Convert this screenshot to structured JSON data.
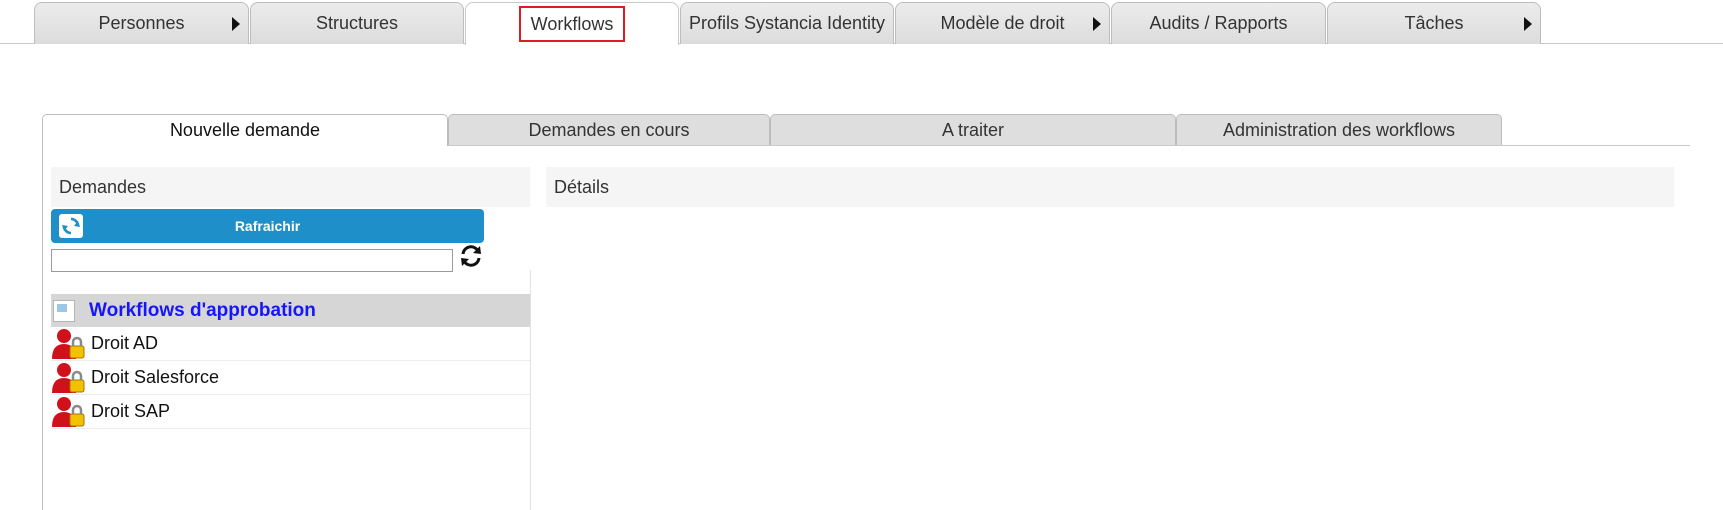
{
  "top_tabs": [
    {
      "label": "Personnes",
      "has_menu": true
    },
    {
      "label": "Structures",
      "has_menu": false
    },
    {
      "label": "Workflows",
      "has_menu": false,
      "active": true,
      "highlighted": true
    },
    {
      "label": "Profils Systancia Identity",
      "has_menu": false
    },
    {
      "label": "Modèle de droit",
      "has_menu": true
    },
    {
      "label": "Audits / Rapports",
      "has_menu": false
    },
    {
      "label": "Tâches",
      "has_menu": true
    }
  ],
  "sub_tabs": [
    {
      "label": "Nouvelle demande",
      "active": true
    },
    {
      "label": "Demandes en cours",
      "active": false
    },
    {
      "label": "A traiter",
      "active": false
    },
    {
      "label": "Administration des workflows",
      "active": false
    }
  ],
  "requests_panel": {
    "title": "Demandes",
    "refresh_label": "Rafraichir",
    "search_value": "",
    "tree_group": {
      "label": "Workflows d'approbation"
    },
    "items": [
      {
        "label": "Droit AD",
        "icon": "user-lock-icon"
      },
      {
        "label": "Droit Salesforce",
        "icon": "user-lock-icon"
      },
      {
        "label": "Droit SAP",
        "icon": "user-lock-icon"
      }
    ]
  },
  "details_panel": {
    "title": "Détails"
  },
  "colors": {
    "refresh_button": "#1e8fc8",
    "highlight": "#e01b24",
    "tree_group_text": "#1515ff",
    "tree_group_background": "#d6d6d6"
  }
}
